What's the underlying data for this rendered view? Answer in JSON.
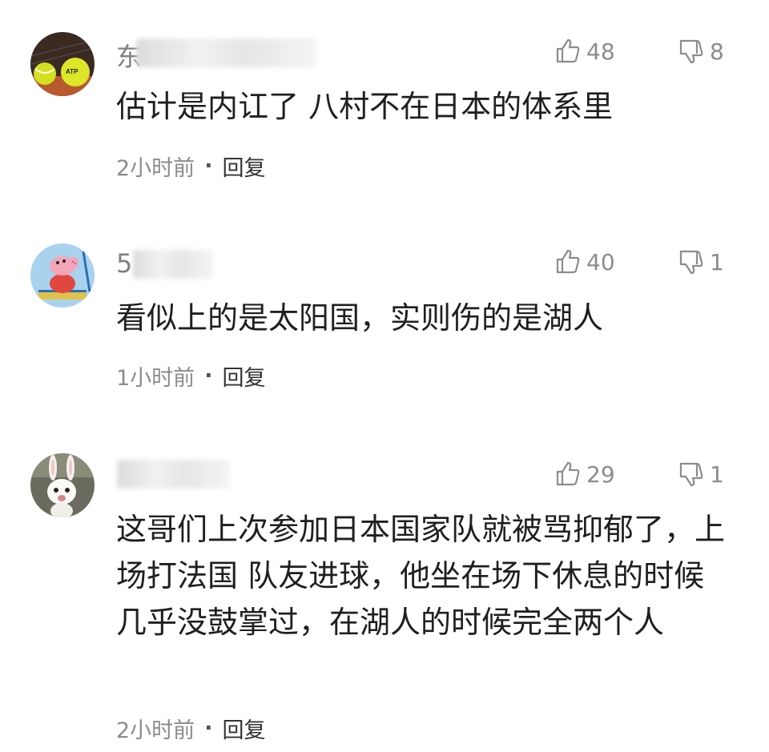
{
  "comments": [
    {
      "username": "东",
      "likes": "48",
      "dislikes": "8",
      "text": "估计是内讧了 八村不在日本的体系里",
      "time": "2小时前",
      "reply": "回复",
      "avatar": "tennis-balls-avatar"
    },
    {
      "username": "5",
      "likes": "40",
      "dislikes": "1",
      "text": "看似上的是太阳国，实则伤的是湖人",
      "time": "1小时前",
      "reply": "回复",
      "avatar": "peppa-pig-avatar"
    },
    {
      "username": "",
      "likes": "29",
      "dislikes": "1",
      "text": "这哥们上次参加日本国家队就被骂抑郁了，上场打法国 队友进球，他坐在场下休息的时候几乎没鼓掌过，在湖人的时候完全两个人",
      "time": "2小时前",
      "reply": "回复",
      "avatar": "rabbid-avatar"
    }
  ],
  "separator": "·",
  "icons": {
    "like": "thumbs-up-outline",
    "dislike": "thumbs-down-outline"
  },
  "colors": {
    "meta": "#8c8c8c",
    "text": "#1f1f1f"
  }
}
